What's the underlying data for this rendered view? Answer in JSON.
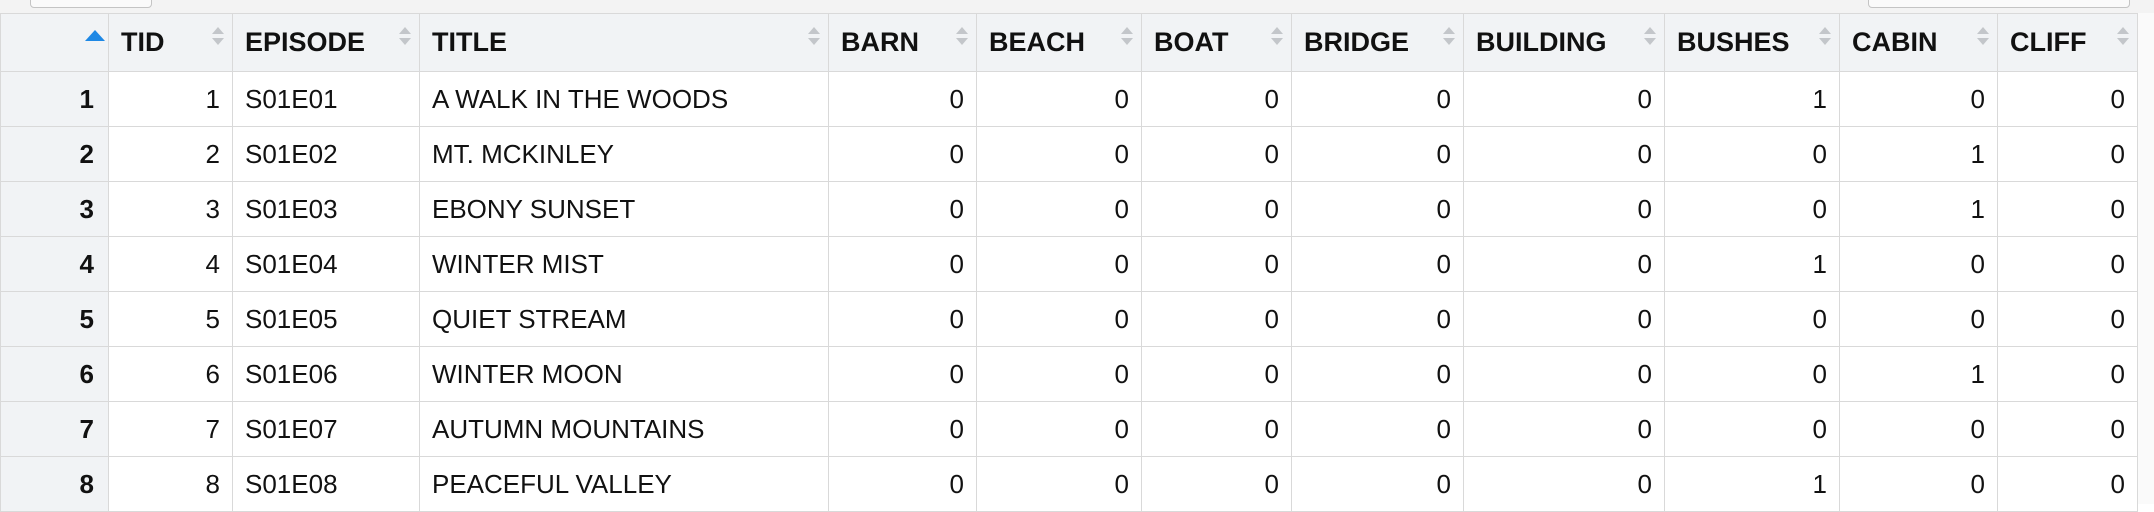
{
  "table": {
    "columns": [
      "TID",
      "EPISODE",
      "TITLE",
      "BARN",
      "BEACH",
      "BOAT",
      "BRIDGE",
      "BUILDING",
      "BUSHES",
      "CABIN",
      "CLIFF"
    ],
    "rows": [
      {
        "row": "1",
        "cells": [
          "1",
          "S01E01",
          "A WALK IN THE WOODS",
          "0",
          "0",
          "0",
          "0",
          "0",
          "1",
          "0",
          "0"
        ]
      },
      {
        "row": "2",
        "cells": [
          "2",
          "S01E02",
          "MT. MCKINLEY",
          "0",
          "0",
          "0",
          "0",
          "0",
          "0",
          "1",
          "0"
        ]
      },
      {
        "row": "3",
        "cells": [
          "3",
          "S01E03",
          "EBONY SUNSET",
          "0",
          "0",
          "0",
          "0",
          "0",
          "0",
          "1",
          "0"
        ]
      },
      {
        "row": "4",
        "cells": [
          "4",
          "S01E04",
          "WINTER MIST",
          "0",
          "0",
          "0",
          "0",
          "0",
          "1",
          "0",
          "0"
        ]
      },
      {
        "row": "5",
        "cells": [
          "5",
          "S01E05",
          "QUIET STREAM",
          "0",
          "0",
          "0",
          "0",
          "0",
          "0",
          "0",
          "0"
        ]
      },
      {
        "row": "6",
        "cells": [
          "6",
          "S01E06",
          "WINTER MOON",
          "0",
          "0",
          "0",
          "0",
          "0",
          "0",
          "1",
          "0"
        ]
      },
      {
        "row": "7",
        "cells": [
          "7",
          "S01E07",
          "AUTUMN MOUNTAINS",
          "0",
          "0",
          "0",
          "0",
          "0",
          "0",
          "0",
          "0"
        ]
      },
      {
        "row": "8",
        "cells": [
          "8",
          "S01E08",
          "PEACEFUL VALLEY",
          "0",
          "0",
          "0",
          "0",
          "0",
          "1",
          "0",
          "0"
        ]
      }
    ]
  },
  "colors": {
    "header_bg": "#f1f3f5",
    "grid_line": "#d9d9d9",
    "sort_active": "#1e88e5"
  }
}
